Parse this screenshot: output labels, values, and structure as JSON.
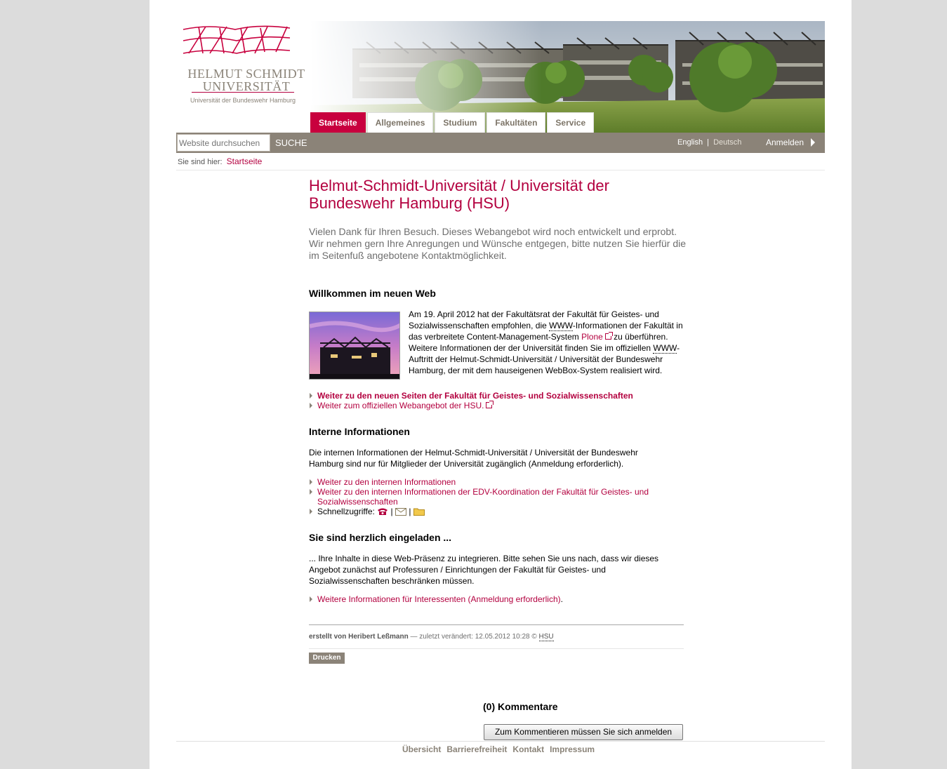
{
  "logo": {
    "line1": "HELMUT SCHMIDT",
    "line2": "UNIVERSITÄT",
    "subtitle": "Universität der Bundeswehr Hamburg"
  },
  "nav": {
    "tabs": [
      "Startseite",
      "Allgemeines",
      "Studium",
      "Fakultäten",
      "Service"
    ],
    "active_tab": "Startseite"
  },
  "toolbar": {
    "search_placeholder": "Website durchsuchen",
    "search_button": "SUCHE",
    "lang_en": "English",
    "lang_sep": "|",
    "lang_de": "Deutsch",
    "login": "Anmelden"
  },
  "breadcrumb": {
    "label": "Sie sind hier:",
    "item": "Startseite"
  },
  "page": {
    "title": "Helmut-Schmidt-Universität / Universität der Bundeswehr Hamburg (HSU)",
    "lead": "Vielen Dank für Ihren Besuch. Dieses Webangebot wird noch entwickelt und erprobt. Wir nehmen gern Ihre Anregungen und Wünsche entgegen, bitte nutzen Sie hierfür die im Seitenfuß angebotene Kontaktmöglichkeit."
  },
  "section1": {
    "heading": "Willkommen im neuen Web",
    "text_a": "Am 19. April 2012 hat der Fakultätsrat der Fakultät für Geistes- und Sozialwissenschaften empfohlen, die ",
    "abbr1": "WWW",
    "text_b": "-Informationen der Fakultät in das verbreitete Content-Management-System ",
    "plone": "Plone",
    "text_c": " zu überführen. Weitere Informationen der der Universität finden Sie im offiziellen ",
    "abbr2": "WWW",
    "text_d": "-Auftritt der Helmut-Schmidt-Universität / Universität der Bundeswehr Hamburg, der mit dem hauseigenen WebBox-System realisiert wird.",
    "link1": "Weiter zu den neuen Seiten der Fakultät für Geistes- und Sozialwissenschaften",
    "link2": "Weiter zum offiziellen Webangebot der HSU."
  },
  "section2": {
    "heading": "Interne Informationen",
    "text": "Die internen Informationen der Helmut-Schmidt-Universität / Universität der Bundeswehr Hamburg sind nur für Mitglieder der Universität zugänglich (Anmeldung erforderlich).",
    "link1": "Weiter zu den internen Informationen",
    "link2": "Weiter zu den internen Informationen der EDV-Koordination der Fakultät für Geistes- und Sozialwissenschaften",
    "quick_label": "Schnellzugriffe:",
    "quick_sep": "|"
  },
  "section3": {
    "heading": "Sie sind herzlich eingeladen ...",
    "text": "... Ihre Inhalte in diese Web-Präsenz zu integrieren. Bitte sehen Sie uns nach, dass wir dieses Angebot zunächst auf Professuren / Einrichtungen der Fakultät für Geistes- und Sozialwissenschaften beschränken müssen.",
    "link1": "Weitere Informationen für Interessenten (Anmeldung erforderlich)",
    "link1_tail": "."
  },
  "byline": {
    "author": "erstellt von Heribert Leßmann",
    "modified": " — zuletzt verändert: 12.05.2012 10:28 © ",
    "org": "HSU"
  },
  "actions": {
    "print": "Drucken"
  },
  "comments": {
    "heading": "(0) Kommentare",
    "button": "Zum Kommentieren müssen Sie sich anmelden"
  },
  "footer": {
    "links": [
      "Übersicht",
      "Barrierefreiheit",
      "Kontakt",
      "Impressum"
    ]
  },
  "colors": {
    "brand": "#c8003e",
    "bar": "#8b8378"
  }
}
